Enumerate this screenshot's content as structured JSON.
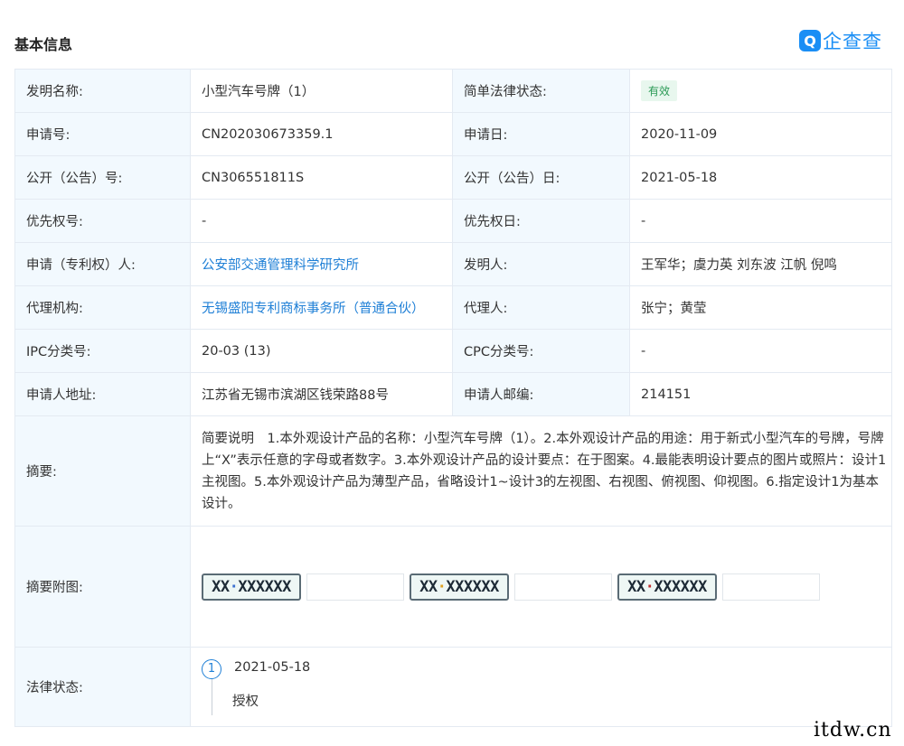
{
  "header": {
    "title": "基本信息",
    "brand_logo": "Q",
    "brand_name": "企查查",
    "brand_color": "#1a8ef5"
  },
  "fields": {
    "invention_name_label": "发明名称:",
    "invention_name": "小型汽车号牌（1）",
    "legal_status_label": "简单法律状态:",
    "legal_status": "有效",
    "app_no_label": "申请号:",
    "app_no": "CN202030673359.1",
    "app_date_label": "申请日:",
    "app_date": "2020-11-09",
    "pub_no_label": "公开（公告）号:",
    "pub_no": "CN306551811S",
    "pub_date_label": "公开（公告）日:",
    "pub_date": "2021-05-18",
    "priority_no_label": "优先权号:",
    "priority_no": "-",
    "priority_date_label": "优先权日:",
    "priority_date": "-",
    "applicant_label": "申请（专利权）人:",
    "applicant": "公安部交通管理科学研究所",
    "inventor_label": "发明人:",
    "inventor": "王军华；虞力英 刘东波 江帆 倪鸣",
    "agency_label": "代理机构:",
    "agency": "无锡盛阳专利商标事务所（普通合伙）",
    "agent_label": "代理人:",
    "agent": "张宁；黄莹",
    "ipc_label": "IPC分类号:",
    "ipc": "20-03 (13)",
    "cpc_label": "CPC分类号:",
    "cpc": "-",
    "address_label": "申请人地址:",
    "address": "江苏省无锡市滨湖区钱荣路88号",
    "postcode_label": "申请人邮编:",
    "postcode": "214151",
    "abstract_label": "摘要:",
    "abstract": "简要说明　1.本外观设计产品的名称：小型汽车号牌（1）。2.本外观设计产品的用途：用于新式小型汽车的号牌，号牌上“X”表示任意的字母或者数字。3.本外观设计产品的设计要点：在于图案。4.最能表明设计要点的图片或照片：设计1主视图。5.本外观设计产品为薄型产品，省略设计1~设计3的左视图、右视图、俯视图、仰视图。6.指定设计1为基本设计。",
    "abstract_images_label": "摘要附图:",
    "legal_state_label": "法律状态:"
  },
  "plates": [
    {
      "text": "XX·XXXXXX",
      "dot_color": "#3b6fd0"
    },
    {
      "text": "XX·XXXXXX",
      "dot_color": "#e0a020"
    },
    {
      "text": "XX·XXXXXX",
      "dot_color": "#c03030"
    }
  ],
  "timeline": [
    {
      "index": "1",
      "date": "2021-05-18",
      "status": "授权"
    }
  ],
  "watermark": "itdw.cn",
  "colors": {
    "label_bg": "#f2f9fe",
    "border": "#e4eaf2",
    "link": "#1e7fd6",
    "badge_bg": "#e8f7ee",
    "badge_text": "#2a9a55"
  }
}
